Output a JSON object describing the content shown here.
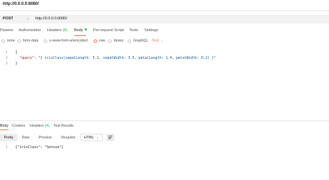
{
  "window": {
    "title": "http://0.0.0.0:8080/"
  },
  "request": {
    "method": "POST",
    "url": "http://0.0.0.0:8080/"
  },
  "tabs": {
    "params": "Params",
    "authorization": "Authorization",
    "headers_label": "Headers",
    "headers_count": "(8)",
    "body": "Body",
    "pre_request": "Pre-request Script",
    "tests": "Tests",
    "settings": "Settings"
  },
  "body_types": {
    "none": "none",
    "form_data": "form-data",
    "urlencoded": "x-www-form-urlencoded",
    "raw": "raw",
    "binary": "binary",
    "graphql": "GraphQL",
    "text_select": "Text",
    "selected": "raw"
  },
  "editor": {
    "line_numbers": [
      "1",
      "2",
      "3"
    ],
    "line1": "{",
    "line2_key": "\"query\"",
    "line2_value": "\"{ irisClass(sepalLength: 5.1, sepalWidth: 3.5, petalLength: 1.4, petalWidth: 0.2) }\"",
    "line3": "}"
  },
  "response_tabs": {
    "body": "Body",
    "cookies": "Cookies",
    "headers_label": "Headers",
    "headers_count": "(4)",
    "test_results": "Test Results"
  },
  "view_tabs": {
    "pretty": "Pretty",
    "raw": "Raw",
    "preview": "Preview",
    "visualize": "Visualize",
    "format": "HTML"
  },
  "response": {
    "line_number": "1",
    "content": "{\"irisClass\": \"Setosa\"}"
  },
  "colors": {
    "accent": "#ff6c37",
    "count_green": "#0cbb52"
  },
  "icons": {
    "chevron": "chevron-down-icon",
    "wrap": "wrap-lines-icon"
  }
}
